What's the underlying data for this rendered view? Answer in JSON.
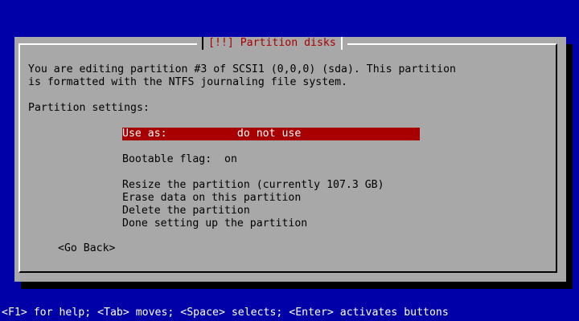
{
  "dialog": {
    "title": "[!!] Partition disks",
    "description_line1": "You are editing partition #3 of SCSI1 (0,0,0) (sda). This partition",
    "description_line2": "is formatted with the NTFS journaling file system.",
    "settings_label": "Partition settings:",
    "menu": {
      "use_as": "Use as:           do not use",
      "bootable_flag": "Bootable flag:  on",
      "resize": "Resize the partition (currently 107.3 GB)",
      "erase": "Erase data on this partition",
      "delete": "Delete the partition",
      "done": "Done setting up the partition",
      "selected": "use_as"
    },
    "go_back": "<Go Back>"
  },
  "status_bar": {
    "text": "<F1> for help; <Tab> moves; <Space> selects; <Enter> activates buttons"
  },
  "colors": {
    "background": "#0000a8",
    "dialog": "#a8a8a8",
    "title": "#a80000",
    "selection": "#a80000",
    "selection_text": "#ffffff",
    "status_text": "#ffffff"
  }
}
